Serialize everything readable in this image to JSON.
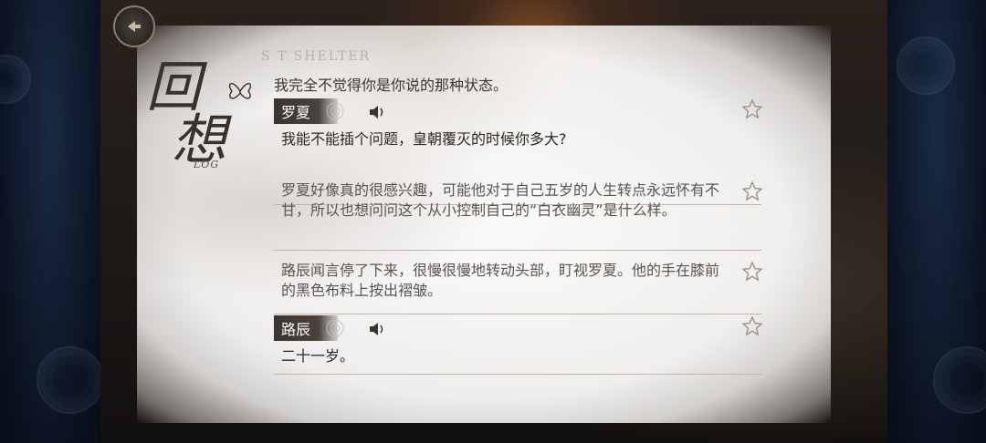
{
  "header": {
    "title_top": "回",
    "title_bottom": "想",
    "title_sub": "LOG",
    "watermark": "S T SHELTER"
  },
  "log": {
    "partial_line": "我完全不觉得你是你说的那种状态。",
    "entries": [
      {
        "speaker": "罗夏",
        "text": "我能不能插个问题，皇朝覆灭的时候你多大?"
      },
      {
        "speaker": "",
        "text": "罗夏好像真的很感兴趣，可能他对于自己五岁的人生转点永远怀有不甘，所以也想问问这个从小控制自己的“白衣幽灵”是什么样。"
      },
      {
        "speaker": "",
        "text": "路辰闻言停了下来，很慢很慢地转动头部，盯视罗夏。他的手在膝前的黑色布料上按出褶皱。"
      },
      {
        "speaker": "路辰",
        "text": "二十一岁。"
      }
    ]
  },
  "icons": {
    "home": "back-arrow-icon",
    "butterfly": "butterfly-icon",
    "rose": "rose-icon",
    "voice": "speaker-icon",
    "star": "star-icon"
  },
  "colors": {
    "speaker_bg": "#3a3430",
    "text": "#2c2725",
    "narration": "#5a5350"
  }
}
